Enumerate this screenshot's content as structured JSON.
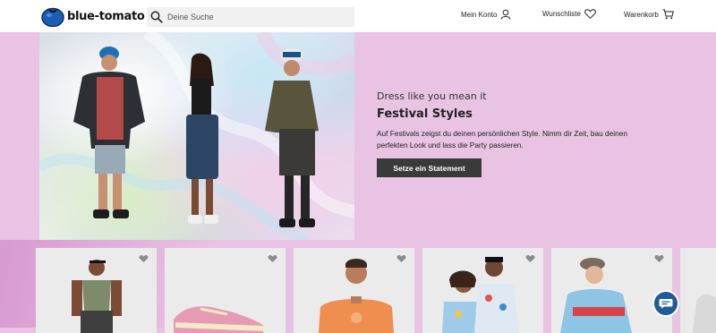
{
  "header": {
    "logo_text": "blue-tomato",
    "search_placeholder": "Deine Suche",
    "account_label": "Mein Konto",
    "wishlist_label": "Wunschliste",
    "cart_label": "Warenkorb"
  },
  "hero": {
    "kicker": "Dress like you mean it",
    "title": "Festival Styles",
    "description": "Auf Festivals zeigst du deinen persönlichen Style. Nimm dir Zeit, bau deinen perfekten Look und lass die Party passieren.",
    "cta_label": "Setze ein Statement"
  },
  "products": [
    {
      "icon": "heart-icon"
    },
    {
      "icon": "heart-icon"
    },
    {
      "icon": "heart-icon"
    },
    {
      "icon": "heart-icon"
    },
    {
      "icon": "heart-icon"
    },
    {
      "icon": "heart-icon"
    }
  ],
  "colors": {
    "background": "#e9c3e3",
    "accent_pink": "#d89ad0",
    "cta": "#3a3a3a",
    "chat": "#1f5a99"
  }
}
